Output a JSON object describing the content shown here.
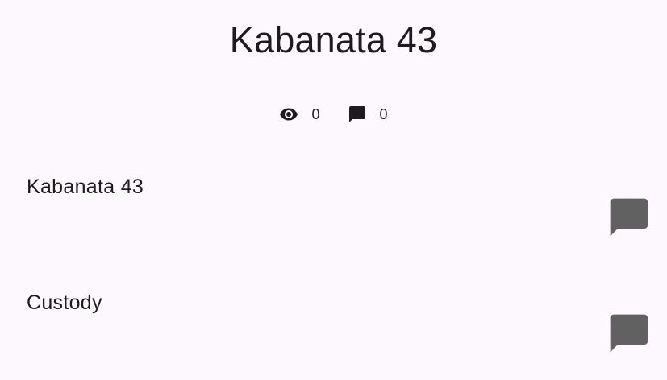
{
  "page": {
    "title": "Kabanata 43"
  },
  "stats": {
    "views": {
      "icon": "eye-icon",
      "value": "0"
    },
    "comments": {
      "icon": "comment-icon",
      "value": "0"
    }
  },
  "rows": [
    {
      "label": "Kabanata 43",
      "action_icon": "comment-icon"
    },
    {
      "label": "Custody",
      "action_icon": "comment-icon"
    }
  ],
  "colors": {
    "background": "#fdf8fd",
    "text": "#1d1b20",
    "icon_dark": "#1d1b20",
    "icon_gray": "#616161"
  }
}
